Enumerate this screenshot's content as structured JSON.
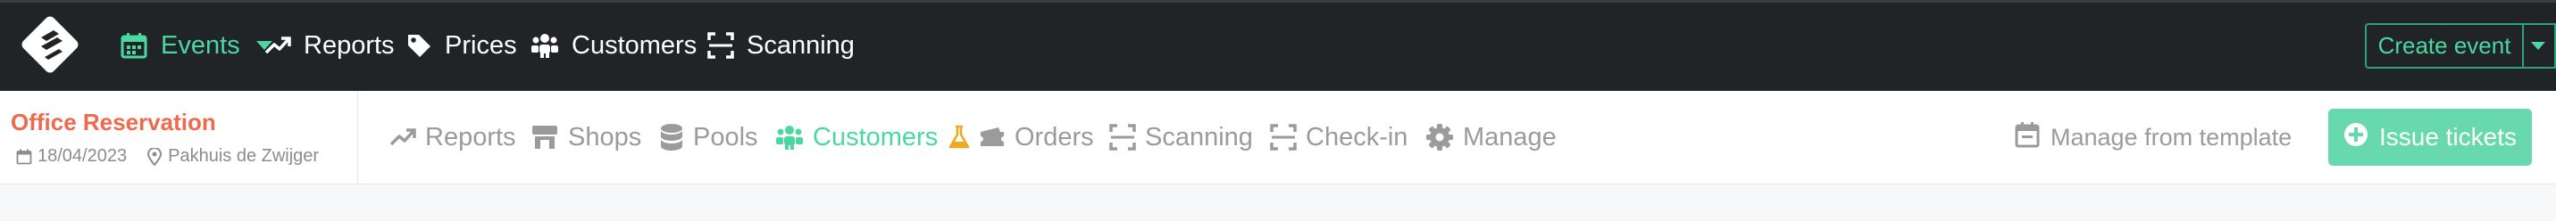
{
  "topnav": {
    "items": [
      {
        "label": "Events",
        "icon": "calendar-icon",
        "active": true,
        "has_caret": true
      },
      {
        "label": "Reports",
        "icon": "trend-chart-icon",
        "active": false
      },
      {
        "label": "Prices",
        "icon": "price-tag-icon",
        "active": false
      },
      {
        "label": "Customers",
        "icon": "users-icon",
        "active": false
      },
      {
        "label": "Scanning",
        "icon": "scan-icon",
        "active": false
      }
    ],
    "create_event_label": "Create event"
  },
  "event": {
    "title": "Office Reservation",
    "date": "18/04/2023",
    "location": "Pakhuis de Zwijger"
  },
  "subnav": {
    "tabs": [
      {
        "label": "Reports",
        "icon": "trend-chart-icon",
        "active": false
      },
      {
        "label": "Shops",
        "icon": "shop-icon",
        "active": false
      },
      {
        "label": "Pools",
        "icon": "database-icon",
        "active": false
      },
      {
        "label": "Customers",
        "icon": "users-icon",
        "active": true
      },
      {
        "label": "Orders",
        "icon": "ticket-icon",
        "active": false,
        "warning_icon": "flask-icon"
      },
      {
        "label": "Scanning",
        "icon": "scan-icon",
        "active": false
      },
      {
        "label": "Check-in",
        "icon": "scan-icon",
        "active": false
      },
      {
        "label": "Manage",
        "icon": "gear-icon",
        "active": false
      }
    ],
    "manage_template_label": "Manage from template",
    "issue_tickets_label": "Issue tickets"
  },
  "colors": {
    "accent": "#4bd7a2",
    "topbar_bg": "#212426",
    "event_title": "#ee6a4d",
    "issue_button_bg": "#68d9ae",
    "warning": "#f0a820",
    "muted": "#9b9b9b"
  }
}
